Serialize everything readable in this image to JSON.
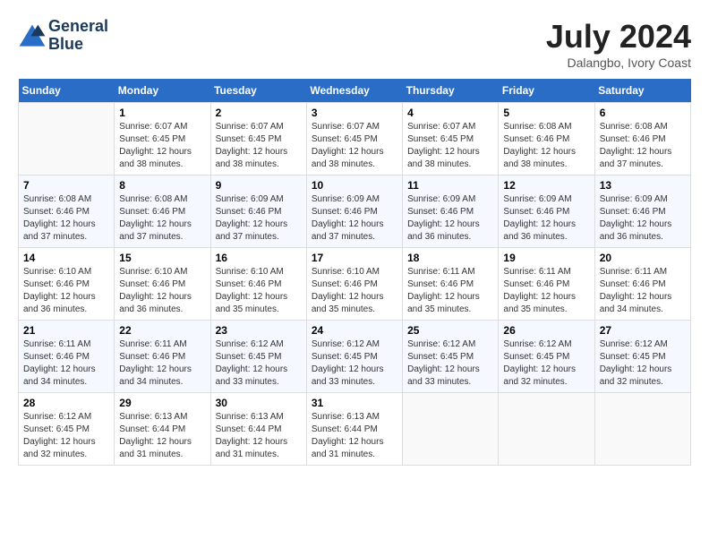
{
  "header": {
    "logo_line1": "General",
    "logo_line2": "Blue",
    "month_year": "July 2024",
    "location": "Dalangbo, Ivory Coast"
  },
  "weekdays": [
    "Sunday",
    "Monday",
    "Tuesday",
    "Wednesday",
    "Thursday",
    "Friday",
    "Saturday"
  ],
  "weeks": [
    [
      {
        "day": "",
        "info": ""
      },
      {
        "day": "1",
        "info": "Sunrise: 6:07 AM\nSunset: 6:45 PM\nDaylight: 12 hours\nand 38 minutes."
      },
      {
        "day": "2",
        "info": "Sunrise: 6:07 AM\nSunset: 6:45 PM\nDaylight: 12 hours\nand 38 minutes."
      },
      {
        "day": "3",
        "info": "Sunrise: 6:07 AM\nSunset: 6:45 PM\nDaylight: 12 hours\nand 38 minutes."
      },
      {
        "day": "4",
        "info": "Sunrise: 6:07 AM\nSunset: 6:45 PM\nDaylight: 12 hours\nand 38 minutes."
      },
      {
        "day": "5",
        "info": "Sunrise: 6:08 AM\nSunset: 6:46 PM\nDaylight: 12 hours\nand 38 minutes."
      },
      {
        "day": "6",
        "info": "Sunrise: 6:08 AM\nSunset: 6:46 PM\nDaylight: 12 hours\nand 37 minutes."
      }
    ],
    [
      {
        "day": "7",
        "info": "Sunrise: 6:08 AM\nSunset: 6:46 PM\nDaylight: 12 hours\nand 37 minutes."
      },
      {
        "day": "8",
        "info": "Sunrise: 6:08 AM\nSunset: 6:46 PM\nDaylight: 12 hours\nand 37 minutes."
      },
      {
        "day": "9",
        "info": "Sunrise: 6:09 AM\nSunset: 6:46 PM\nDaylight: 12 hours\nand 37 minutes."
      },
      {
        "day": "10",
        "info": "Sunrise: 6:09 AM\nSunset: 6:46 PM\nDaylight: 12 hours\nand 37 minutes."
      },
      {
        "day": "11",
        "info": "Sunrise: 6:09 AM\nSunset: 6:46 PM\nDaylight: 12 hours\nand 36 minutes."
      },
      {
        "day": "12",
        "info": "Sunrise: 6:09 AM\nSunset: 6:46 PM\nDaylight: 12 hours\nand 36 minutes."
      },
      {
        "day": "13",
        "info": "Sunrise: 6:09 AM\nSunset: 6:46 PM\nDaylight: 12 hours\nand 36 minutes."
      }
    ],
    [
      {
        "day": "14",
        "info": "Sunrise: 6:10 AM\nSunset: 6:46 PM\nDaylight: 12 hours\nand 36 minutes."
      },
      {
        "day": "15",
        "info": "Sunrise: 6:10 AM\nSunset: 6:46 PM\nDaylight: 12 hours\nand 36 minutes."
      },
      {
        "day": "16",
        "info": "Sunrise: 6:10 AM\nSunset: 6:46 PM\nDaylight: 12 hours\nand 35 minutes."
      },
      {
        "day": "17",
        "info": "Sunrise: 6:10 AM\nSunset: 6:46 PM\nDaylight: 12 hours\nand 35 minutes."
      },
      {
        "day": "18",
        "info": "Sunrise: 6:11 AM\nSunset: 6:46 PM\nDaylight: 12 hours\nand 35 minutes."
      },
      {
        "day": "19",
        "info": "Sunrise: 6:11 AM\nSunset: 6:46 PM\nDaylight: 12 hours\nand 35 minutes."
      },
      {
        "day": "20",
        "info": "Sunrise: 6:11 AM\nSunset: 6:46 PM\nDaylight: 12 hours\nand 34 minutes."
      }
    ],
    [
      {
        "day": "21",
        "info": "Sunrise: 6:11 AM\nSunset: 6:46 PM\nDaylight: 12 hours\nand 34 minutes."
      },
      {
        "day": "22",
        "info": "Sunrise: 6:11 AM\nSunset: 6:46 PM\nDaylight: 12 hours\nand 34 minutes."
      },
      {
        "day": "23",
        "info": "Sunrise: 6:12 AM\nSunset: 6:45 PM\nDaylight: 12 hours\nand 33 minutes."
      },
      {
        "day": "24",
        "info": "Sunrise: 6:12 AM\nSunset: 6:45 PM\nDaylight: 12 hours\nand 33 minutes."
      },
      {
        "day": "25",
        "info": "Sunrise: 6:12 AM\nSunset: 6:45 PM\nDaylight: 12 hours\nand 33 minutes."
      },
      {
        "day": "26",
        "info": "Sunrise: 6:12 AM\nSunset: 6:45 PM\nDaylight: 12 hours\nand 32 minutes."
      },
      {
        "day": "27",
        "info": "Sunrise: 6:12 AM\nSunset: 6:45 PM\nDaylight: 12 hours\nand 32 minutes."
      }
    ],
    [
      {
        "day": "28",
        "info": "Sunrise: 6:12 AM\nSunset: 6:45 PM\nDaylight: 12 hours\nand 32 minutes."
      },
      {
        "day": "29",
        "info": "Sunrise: 6:13 AM\nSunset: 6:44 PM\nDaylight: 12 hours\nand 31 minutes."
      },
      {
        "day": "30",
        "info": "Sunrise: 6:13 AM\nSunset: 6:44 PM\nDaylight: 12 hours\nand 31 minutes."
      },
      {
        "day": "31",
        "info": "Sunrise: 6:13 AM\nSunset: 6:44 PM\nDaylight: 12 hours\nand 31 minutes."
      },
      {
        "day": "",
        "info": ""
      },
      {
        "day": "",
        "info": ""
      },
      {
        "day": "",
        "info": ""
      }
    ]
  ]
}
